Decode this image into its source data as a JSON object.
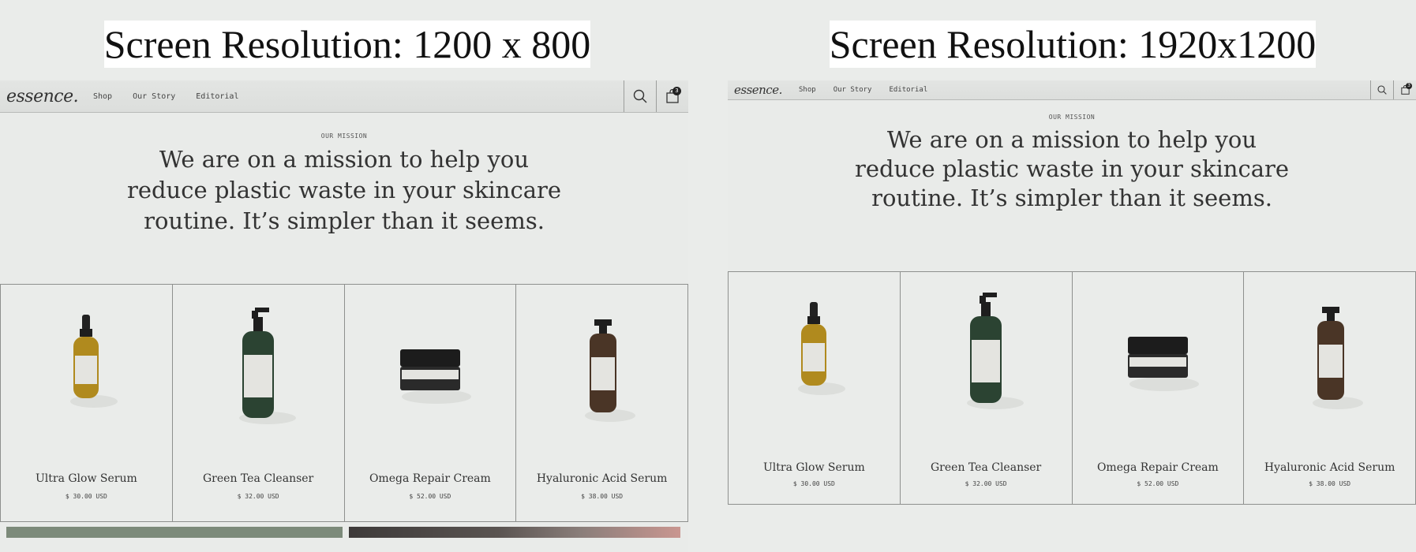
{
  "labels": {
    "left": "Screen Resolution: 1200 x 800",
    "right": "Screen Resolution: 1920x1200"
  },
  "nav": {
    "logo": "essence.",
    "links": [
      "Shop",
      "Our Story",
      "Editorial"
    ],
    "cart_count": "3"
  },
  "mission": {
    "kicker": "OUR MISSION",
    "text": "We are on a mission to help you reduce plastic waste in your skincare routine. It’s simpler than it seems."
  },
  "products": [
    {
      "name": "Ultra Glow Serum",
      "price": "$ 30.00 USD",
      "kind": "dropper",
      "color": "#b08a1e"
    },
    {
      "name": "Green Tea Cleanser",
      "price": "$ 32.00 USD",
      "kind": "pump",
      "color": "#2b4332"
    },
    {
      "name": "Omega Repair Cream",
      "price": "$ 52.00 USD",
      "kind": "jar",
      "color": "#1c1c1c"
    },
    {
      "name": "Hyaluronic Acid Serum",
      "price": "$ 38.00 USD",
      "kind": "pump-small",
      "color": "#4a3526"
    }
  ],
  "icons": {
    "search": "search-icon",
    "cart": "shopping-bag-icon"
  }
}
